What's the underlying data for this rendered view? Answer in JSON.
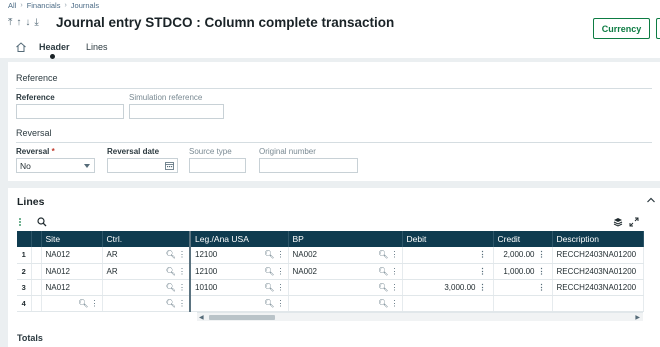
{
  "breadcrumb": [
    "All",
    "Financials",
    "Journals"
  ],
  "title": "Journal entry STDCO : Column complete transaction",
  "currency_button": "Currency",
  "tabs": {
    "header": "Header",
    "lines": "Lines"
  },
  "reference_section": {
    "label": "Reference",
    "reference_label": "Reference",
    "reference_value": "",
    "simulation_label": "Simulation reference",
    "simulation_value": ""
  },
  "reversal_section": {
    "label": "Reversal",
    "reversal_label": "Reversal",
    "reversal_value": "No",
    "reversal_date_label": "Reversal date",
    "reversal_date_value": "",
    "source_type_label": "Source type",
    "source_type_value": "",
    "original_number_label": "Original number",
    "original_number_value": ""
  },
  "lines": {
    "title": "Lines",
    "columns": [
      "Site",
      "Ctrl.",
      "Leg./Ana USA",
      "BP",
      "Debit",
      "Credit",
      "Description"
    ],
    "rows": [
      {
        "n": "1",
        "site": "NA012",
        "ctrl": "AR",
        "leg": "12100",
        "bp": "NA002",
        "debit": "",
        "credit": "2,000.00",
        "desc": "RECCH2403NA01200"
      },
      {
        "n": "2",
        "site": "NA012",
        "ctrl": "AR",
        "leg": "12100",
        "bp": "NA002",
        "debit": "",
        "credit": "1,000.00",
        "desc": "RECCH2403NA01200"
      },
      {
        "n": "3",
        "site": "NA012",
        "ctrl": "",
        "leg": "10100",
        "bp": "",
        "debit": "3,000.00",
        "credit": "",
        "desc": "RECCH2403NA01200"
      },
      {
        "n": "4",
        "site": "",
        "ctrl": "",
        "leg": "",
        "bp": "",
        "debit": "",
        "credit": "",
        "desc": ""
      }
    ]
  },
  "totals_label": "Totals",
  "colors": {
    "accent": "#0d7c43",
    "grid_header": "#0f3b4f"
  }
}
